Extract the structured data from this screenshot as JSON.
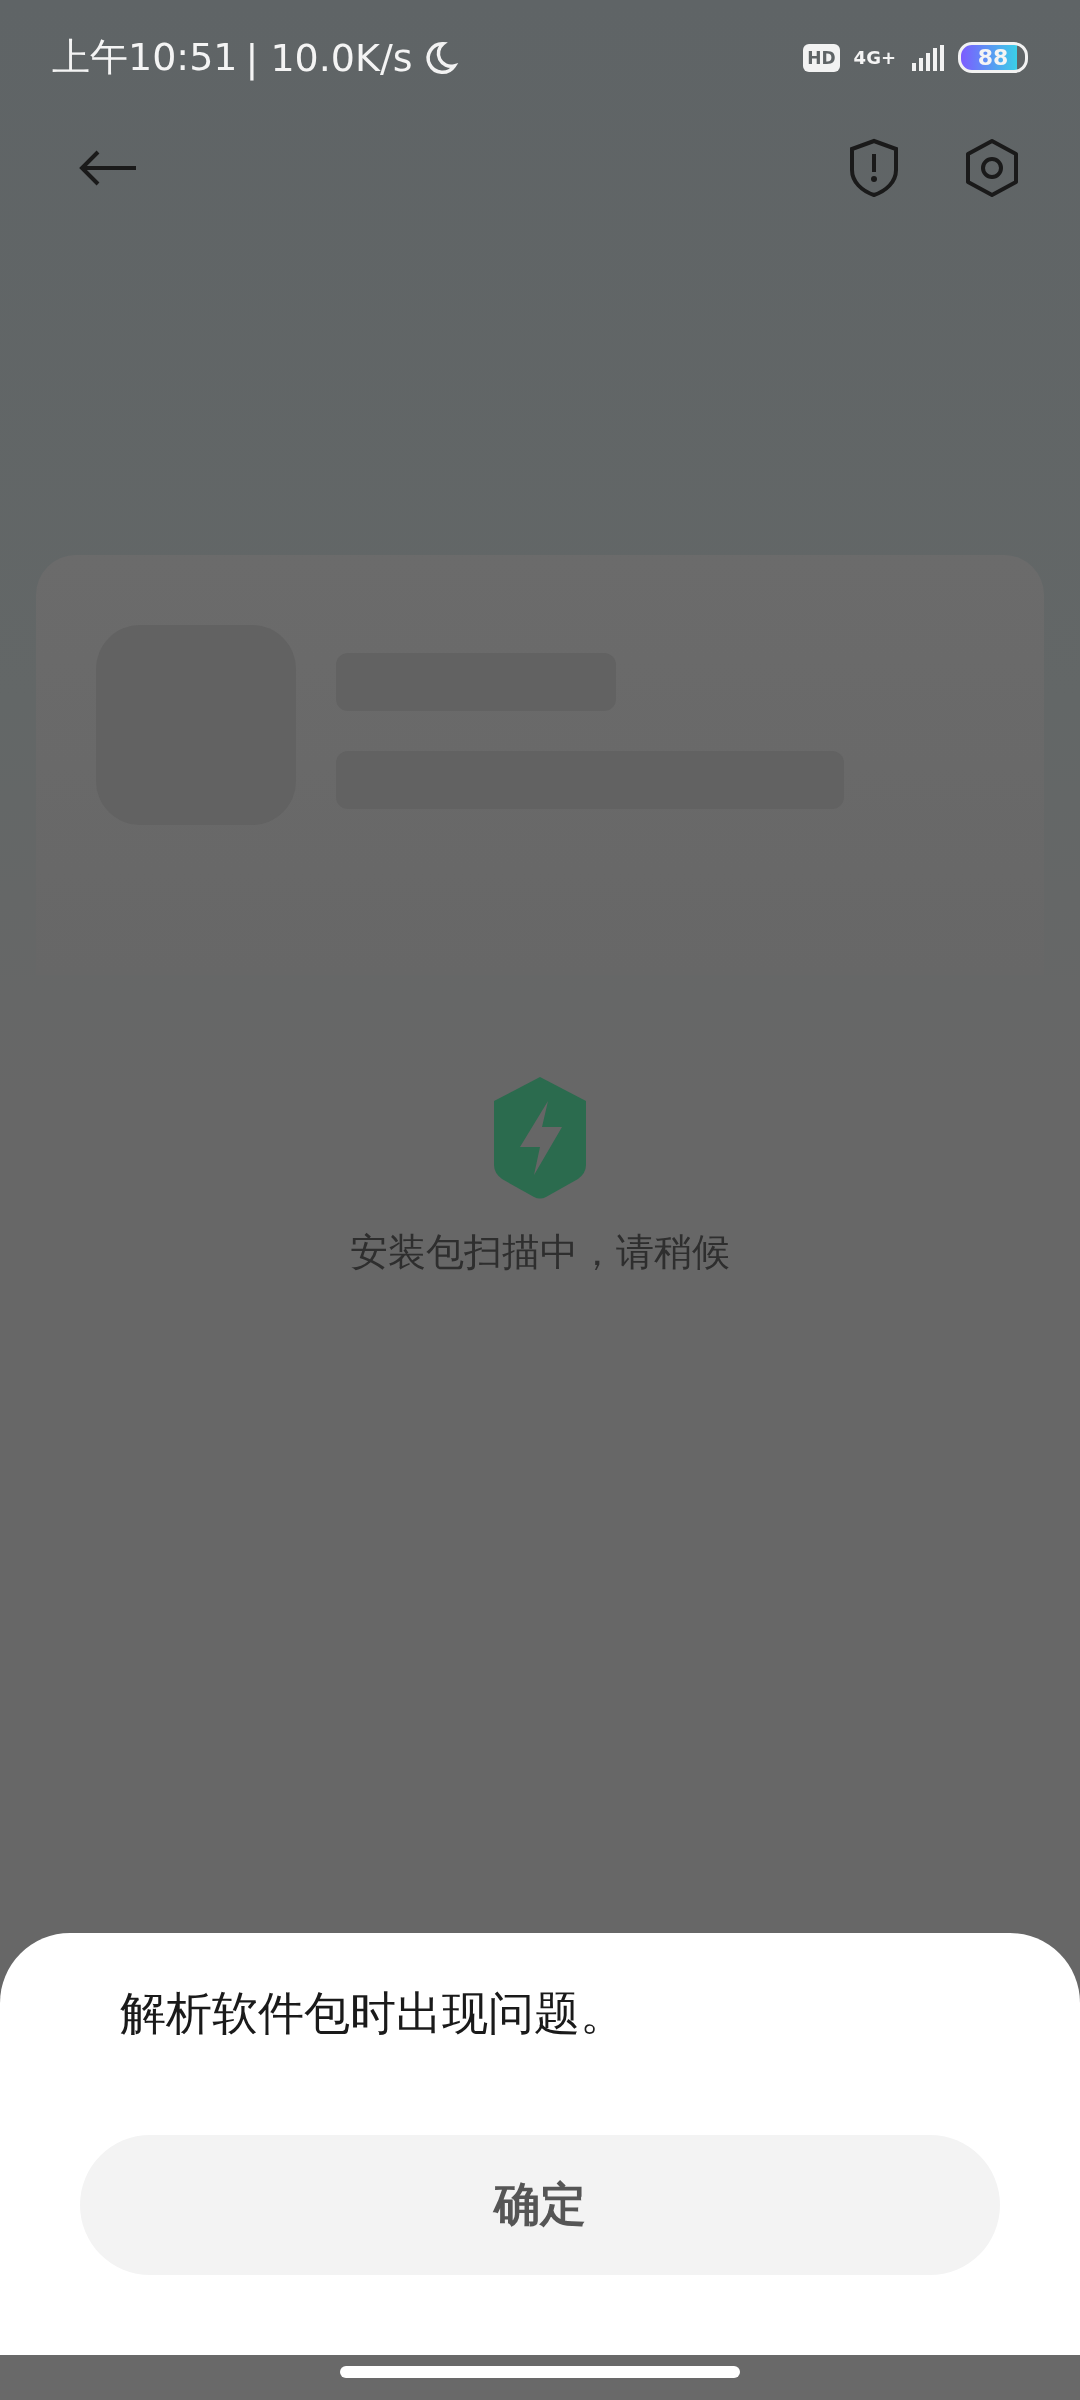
{
  "status_bar": {
    "time": "上午10:51",
    "speed": "| 10.0K/s",
    "hd": "HD",
    "network": "4G+",
    "battery": "88"
  },
  "scan": {
    "message": "安装包扫描中，请稍候"
  },
  "dialog": {
    "message": "解析软件包时出现问题。",
    "buttons": [
      "确定"
    ]
  }
}
